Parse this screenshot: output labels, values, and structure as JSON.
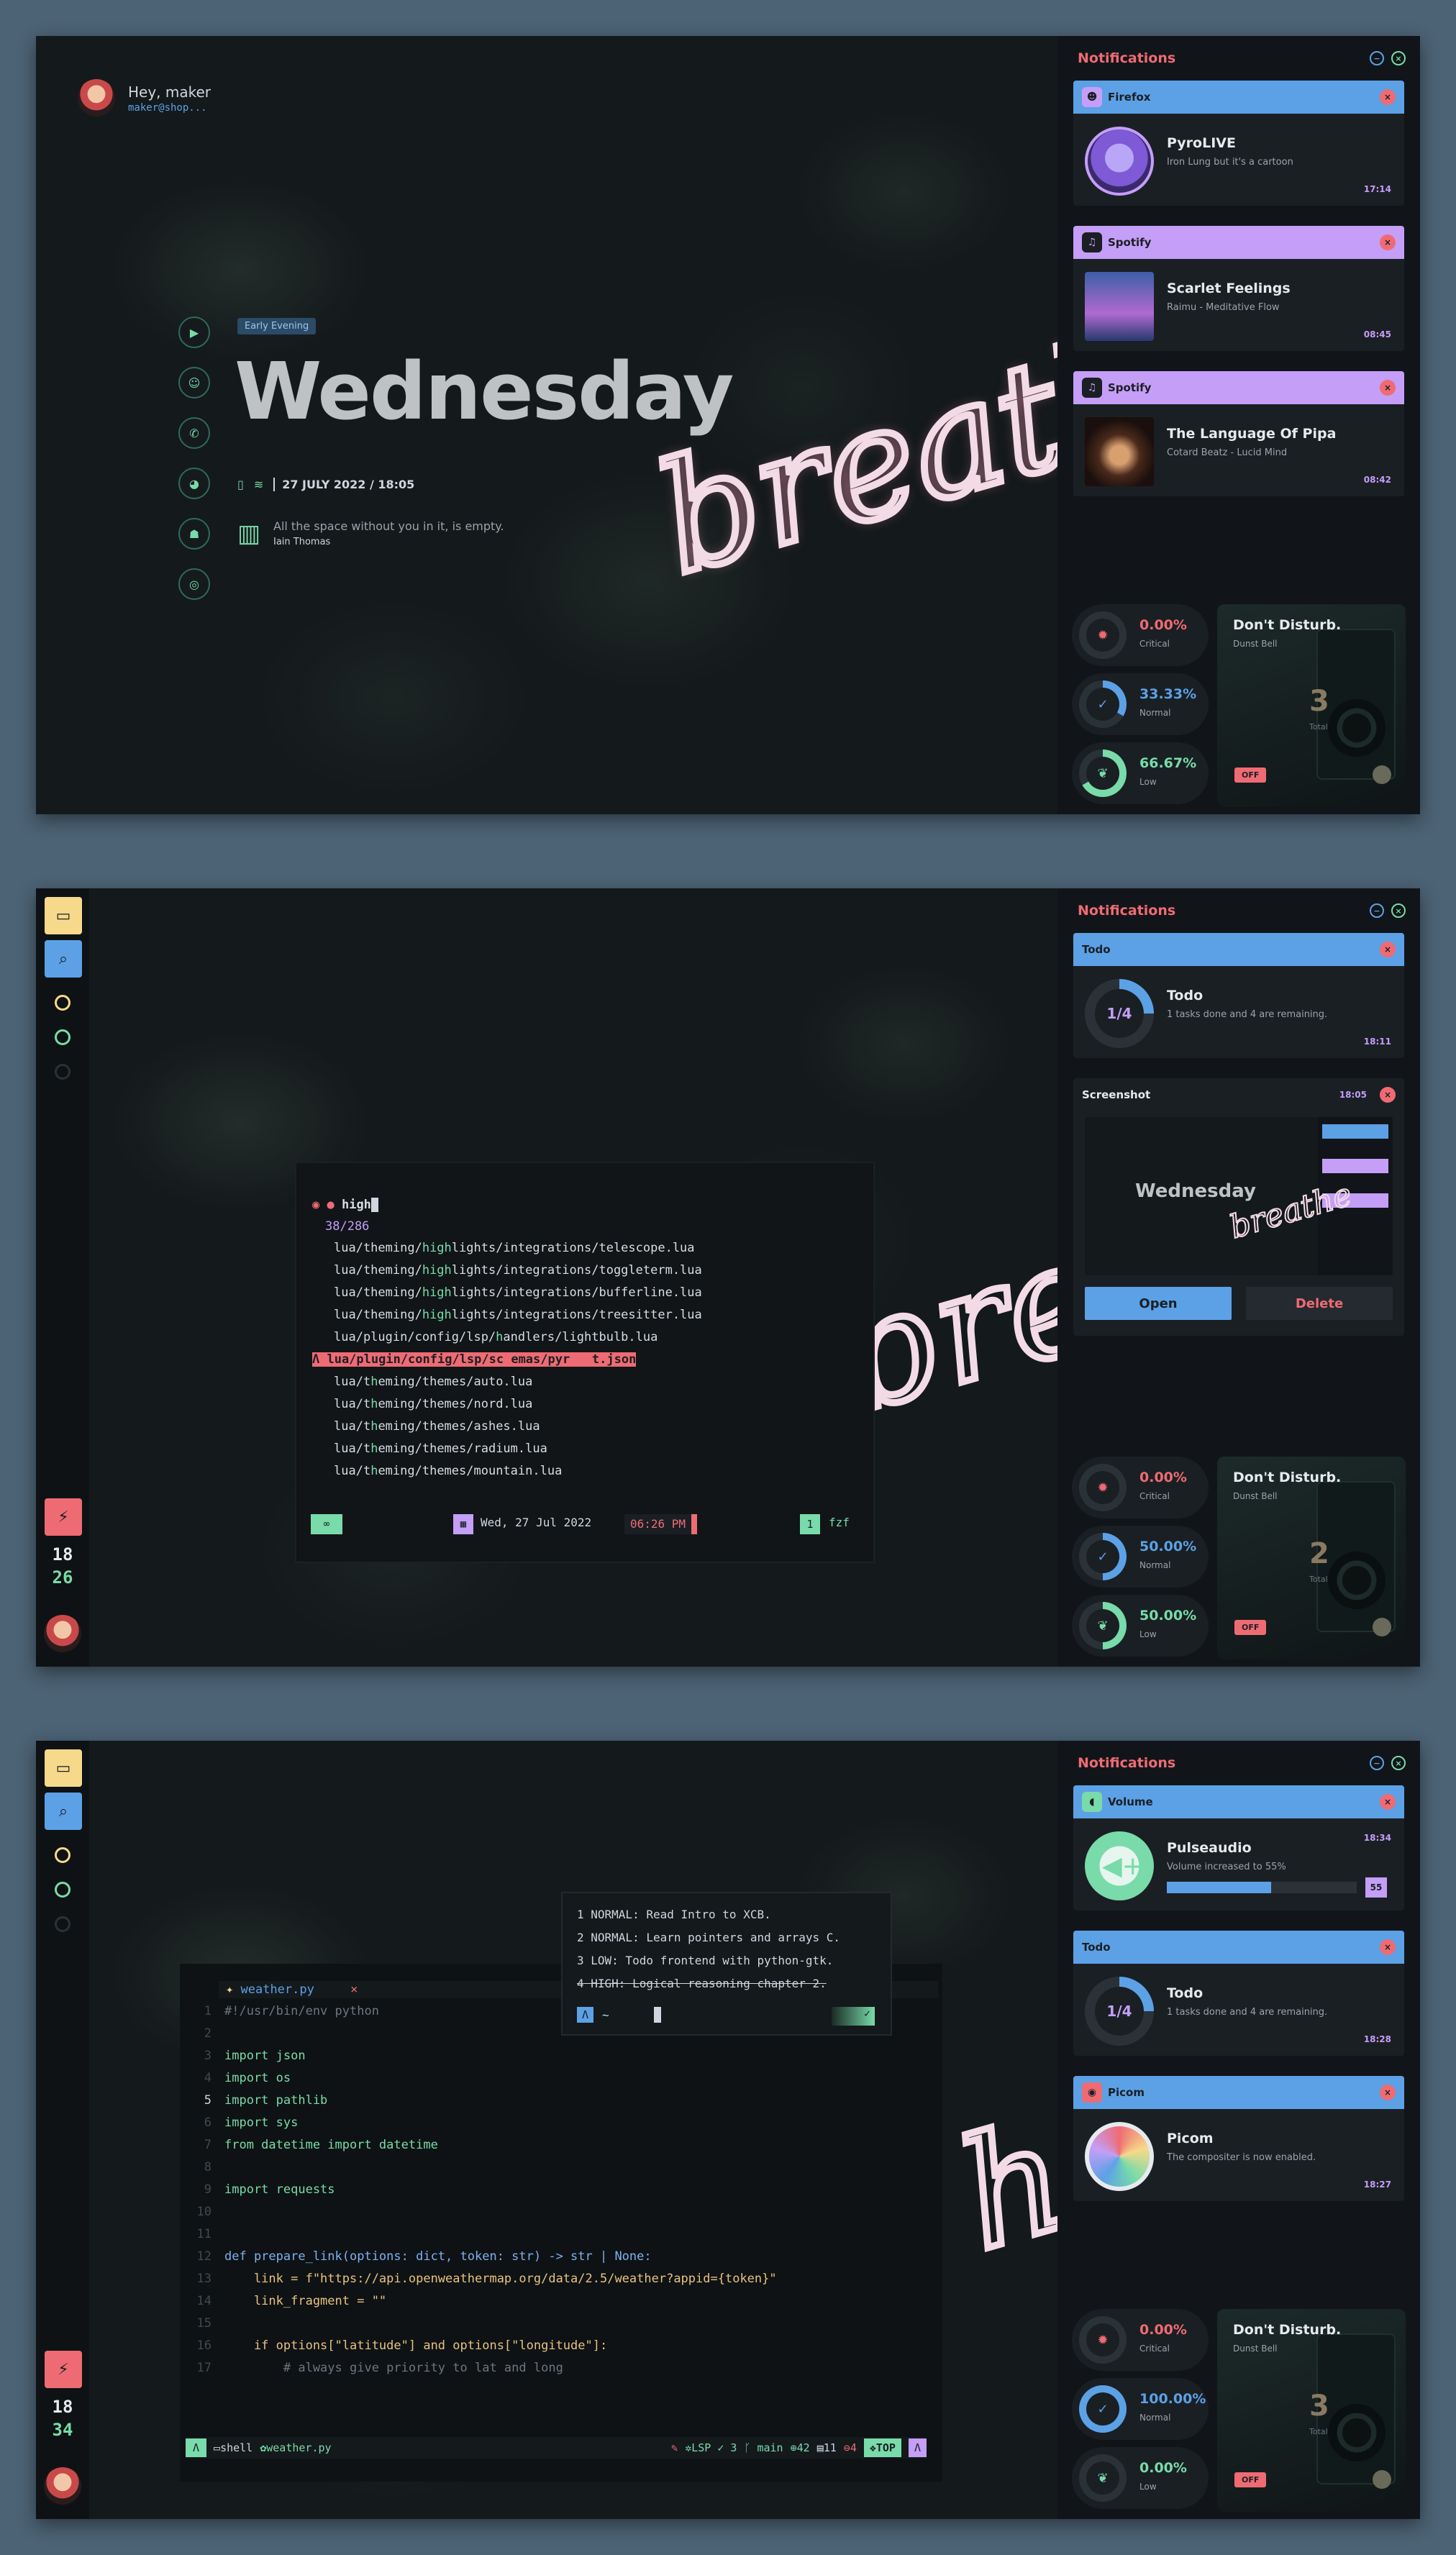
{
  "colors": {
    "red": "#ef6b73",
    "blue": "#5ca1e6",
    "purple": "#c49ef7",
    "green": "#78dba9",
    "yellow": "#f6d98a",
    "bg": "#101417",
    "card": "#1a1f24"
  },
  "shot1": {
    "greeting": "Hey, maker",
    "user_handle": "maker@shop...",
    "badge": "Early Evening",
    "day": "Wednesday",
    "date": "27 JULY 2022 / 18:05",
    "quote": "All the space without you in it, is empty.",
    "quote_author": "Iain Thomas",
    "wall_text": "breathe",
    "social_icons": [
      "youtube-icon",
      "discord-icon",
      "whatsapp-icon",
      "reddit-icon",
      "github-icon",
      "gamepad-icon"
    ],
    "notifications": [
      {
        "app": "Firefox",
        "title": "PyroLIVE",
        "body": "Iron Lung but it's a cartoon",
        "time": "17:14"
      },
      {
        "app": "Spotify",
        "title": "Scarlet Feelings",
        "body": "Raimu - Meditative Flow",
        "time": "08:45"
      },
      {
        "app": "Spotify",
        "title": "The Language Of Pipa",
        "body": "Cotard Beatz - Lucid Mind",
        "time": "08:42"
      }
    ],
    "stats": [
      {
        "pct": "0.00%",
        "label": "Critical",
        "value": 0
      },
      {
        "pct": "33.33%",
        "label": "Normal",
        "value": 33.33
      },
      {
        "pct": "66.67%",
        "label": "Low",
        "value": 66.67
      }
    ],
    "dnd": {
      "title": "Don't Disturb.",
      "sub": "Dunst Bell",
      "count": "3",
      "total": "Total",
      "off": "OFF"
    }
  },
  "panel_title": "Notifications",
  "shot2": {
    "wall_text": "breathe",
    "clock_h": "18",
    "clock_m": "26",
    "query": "high",
    "count": "38/286",
    "results": [
      {
        "pre": "lua/theming/",
        "hl": "high",
        "post": "lights/integrations/telescope.lua"
      },
      {
        "pre": "lua/theming/",
        "hl": "high",
        "post": "lights/integrations/toggleterm.lua"
      },
      {
        "pre": "lua/theming/",
        "hl": "high",
        "post": "lights/integrations/bufferline.lua"
      },
      {
        "pre": "lua/theming/",
        "hl": "high",
        "post": "lights/integrations/treesitter.lua"
      },
      {
        "pre": "lua/plugin/config/lsp/",
        "hl": "h",
        "post": "andlers/lightbulb.lua"
      },
      {
        "pre": "",
        "hl": "",
        "post": "lua/plugin/config/lsp/sc emas/pyr   t.json",
        "selected": true
      },
      {
        "pre": "lua/t",
        "hl": "h",
        "post": "eming/themes/auto.lua"
      },
      {
        "pre": "lua/t",
        "hl": "h",
        "post": "eming/themes/nord.lua"
      },
      {
        "pre": "lua/t",
        "hl": "h",
        "post": "eming/themes/ashes.lua"
      },
      {
        "pre": "lua/t",
        "hl": "h",
        "post": "eming/themes/radium.lua"
      },
      {
        "pre": "lua/t",
        "hl": "h",
        "post": "eming/themes/mountain.lua"
      }
    ],
    "status_date": "Wed, 27 Jul 2022",
    "status_time": "06:26 PM",
    "status_mode": "1",
    "status_name": "fzf",
    "todo": {
      "app": "Todo",
      "title": "Todo",
      "body": "1 tasks done and 4 are remaining.",
      "frac": "1/4",
      "time": "18:11",
      "value": 0.25
    },
    "screenshot": {
      "app": "Screenshot",
      "time": "18:05",
      "open": "Open",
      "delete": "Delete",
      "preview_day": "Wednesday",
      "preview_wall": "breathe"
    },
    "stats": [
      {
        "pct": "0.00%",
        "label": "Critical",
        "value": 0
      },
      {
        "pct": "50.00%",
        "label": "Normal",
        "value": 50
      },
      {
        "pct": "50.00%",
        "label": "Low",
        "value": 50
      }
    ],
    "dnd": {
      "title": "Don't Disturb.",
      "sub": "Dunst Bell",
      "count": "2",
      "total": "Total",
      "off": "OFF"
    }
  },
  "shot3": {
    "wall_text": "he",
    "clock_h": "18",
    "clock_m": "34",
    "file_tab": "weather.py",
    "code": [
      {
        "n": "1",
        "t": "#!/usr/bin/env python"
      },
      {
        "n": "2",
        "t": ""
      },
      {
        "n": "3",
        "t": "import json"
      },
      {
        "n": "4",
        "t": "import os"
      },
      {
        "n": "5",
        "t": "import pathlib"
      },
      {
        "n": "6",
        "t": "import sys"
      },
      {
        "n": "7",
        "t": "from datetime import datetime"
      },
      {
        "n": "8",
        "t": ""
      },
      {
        "n": "9",
        "t": "import requests"
      },
      {
        "n": "10",
        "t": ""
      },
      {
        "n": "11",
        "t": ""
      },
      {
        "n": "12",
        "t": "def prepare_link(options: dict, token: str) -> str | None:"
      },
      {
        "n": "13",
        "t": "    link = f\"https://api.openweathermap.org/data/2.5/weather?appid={token}\""
      },
      {
        "n": "14",
        "t": "    link_fragment = \"\""
      },
      {
        "n": "15",
        "t": ""
      },
      {
        "n": "16",
        "t": "    if options[\"latitude\"] and options[\"longitude\"]:"
      },
      {
        "n": "17",
        "t": "        # always give priority to lat and long"
      }
    ],
    "todos": [
      "1 NORMAL: Read Intro to XCB.",
      "2 NORMAL: Learn pointers and arrays C.",
      "3 LOW: Todo frontend with python-gtk.",
      "4 HIGH: Logical reasoning chapter 2."
    ],
    "todo_prompt": "~",
    "statusline": {
      "shell": "shell",
      "file": "weather.py",
      "lsp": "LSP",
      "lsp_count": "3",
      "branch": "main",
      "added": "42",
      "changed": "11",
      "removed": "4",
      "pos": "TOP"
    },
    "volume": {
      "app": "Volume",
      "title": "Pulseaudio",
      "body": "Volume increased to 55%",
      "time": "18:34",
      "level": "55",
      "value": 0.55
    },
    "todo": {
      "app": "Todo",
      "title": "Todo",
      "body": "1 tasks done and 4 are remaining.",
      "frac": "1/4",
      "time": "18:28",
      "value": 0.25
    },
    "picom": {
      "app": "Picom",
      "title": "Picom",
      "body": "The compositer is now enabled.",
      "time": "18:27"
    },
    "stats": [
      {
        "pct": "0.00%",
        "label": "Critical",
        "value": 0
      },
      {
        "pct": "100.00%",
        "label": "Normal",
        "value": 100
      },
      {
        "pct": "0.00%",
        "label": "Low",
        "value": 0
      }
    ],
    "dnd": {
      "title": "Don't Disturb.",
      "sub": "Dunst Bell",
      "count": "3",
      "total": "Total",
      "off": "OFF"
    }
  }
}
